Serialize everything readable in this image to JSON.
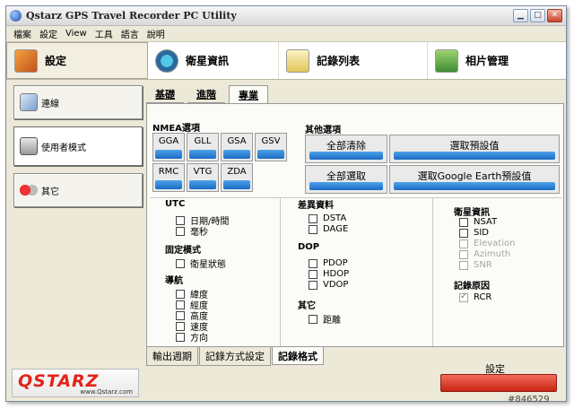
{
  "window": {
    "title": "Qstarz GPS Travel Recorder PC Utility"
  },
  "menu": [
    "檔案",
    "設定",
    "View",
    "工具",
    "語言",
    "說明"
  ],
  "main_tabs": [
    {
      "label": "設定",
      "icon": "settings-icon"
    },
    {
      "label": "衛星資訊",
      "icon": "satellite-icon"
    },
    {
      "label": "記錄列表",
      "icon": "log-list-icon"
    },
    {
      "label": "相片管理",
      "icon": "photo-icon"
    }
  ],
  "sidebar": [
    {
      "label": "連線",
      "icon": "connect-icon"
    },
    {
      "label": "使用者模式",
      "icon": "user-mode-icon"
    },
    {
      "label": "其它",
      "icon": "other-icon"
    }
  ],
  "sub_tabs": [
    "基礎",
    "進階",
    "專業"
  ],
  "nmea": {
    "title": "NMEA選項",
    "buttons": [
      "GGA",
      "GLL",
      "GSA",
      "GSV",
      "RMC",
      "VTG",
      "ZDA"
    ]
  },
  "other_options": {
    "title": "其他選項",
    "clear_all": "全部清除",
    "select_all": "全部選取",
    "select_default": "選取預設值",
    "select_google_earth": "選取Google Earth預設值"
  },
  "utc": {
    "title": "UTC",
    "options": [
      "日期/時間",
      "毫秒"
    ]
  },
  "fix_mode": {
    "title": "固定模式",
    "options": [
      "衛星狀態"
    ]
  },
  "navigation": {
    "title": "導航",
    "options": [
      "緯度",
      "經度",
      "高度",
      "速度",
      "方向"
    ]
  },
  "diff": {
    "title": "差異資料",
    "options": [
      "DSTA",
      "DAGE"
    ]
  },
  "dop": {
    "title": "DOP",
    "options": [
      "PDOP",
      "HDOP",
      "VDOP"
    ]
  },
  "misc": {
    "title": "其它",
    "options": [
      "距離"
    ]
  },
  "satellite_info": {
    "title": "衛星資訊",
    "options": [
      "NSAT",
      "SID",
      "Elevation",
      "Azimuth",
      "SNR"
    ]
  },
  "log_reason": {
    "title": "記錄原因",
    "options": [
      "RCR"
    ]
  },
  "bottom_tabs": [
    "輸出週期",
    "記錄方式設定",
    "記錄格式"
  ],
  "apply": {
    "label": "設定"
  },
  "logo": {
    "brand": "QSTARZ",
    "url": "www.Qstarz.com"
  },
  "watermark": "#846529",
  "colors": {
    "accent_blue": "#1b6cc4",
    "apply_red": "#c82512",
    "brand_red": "#e2231a"
  }
}
